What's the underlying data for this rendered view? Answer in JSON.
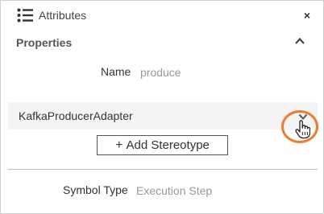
{
  "header": {
    "title": "Attributes",
    "close_label": "×"
  },
  "properties": {
    "section_title": "Properties",
    "name": {
      "label": "Name",
      "value": "produce"
    }
  },
  "stereotype": {
    "name": "KafkaProducerAdapter",
    "add_label": "Add Stereotype",
    "add_icon": "+"
  },
  "symbol_type": {
    "label": "Symbol Type",
    "value": "Execution Step"
  },
  "colors": {
    "highlight": "#f07a2f",
    "row_background": "#f4f4f4"
  }
}
